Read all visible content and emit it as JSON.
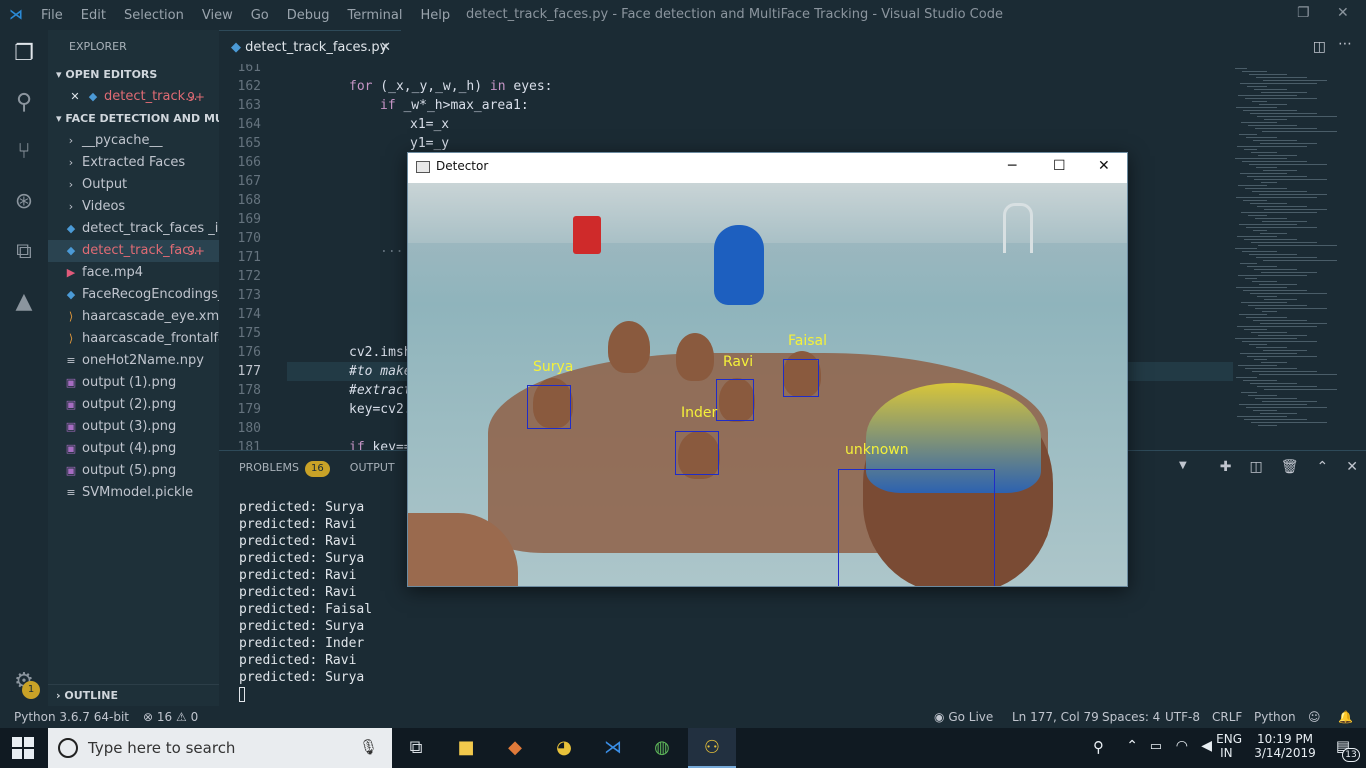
{
  "app": {
    "title": "detect_track_faces.py - Face detection and MultiFace Tracking - Visual Studio Code",
    "menu": [
      "File",
      "Edit",
      "Selection",
      "View",
      "Go",
      "Debug",
      "Terminal",
      "Help"
    ]
  },
  "sidebar": {
    "header": "EXPLORER",
    "open_editors_label": "OPEN EDITORS",
    "open_editor": {
      "name": "detect_track...",
      "count": "9+"
    },
    "project_label": "FACE DETECTION AND MU...",
    "items": [
      {
        "label": "__pycache__",
        "icon": "chevron-right-icon",
        "glyph": "›"
      },
      {
        "label": "Extracted Faces",
        "icon": "chevron-right-icon",
        "glyph": "›"
      },
      {
        "label": "Output",
        "icon": "chevron-right-icon",
        "glyph": "›"
      },
      {
        "label": "Videos",
        "icon": "chevron-right-icon",
        "glyph": "›"
      },
      {
        "label": "detect_track_faces _i...",
        "icon": "python-file-icon",
        "glyph": "◆"
      },
      {
        "label": "detect_track_fac...",
        "icon": "python-file-icon",
        "glyph": "◆",
        "count": "9+"
      },
      {
        "label": "face.mp4",
        "icon": "video-file-icon",
        "glyph": "▶"
      },
      {
        "label": "FaceRecogEncodings_...",
        "icon": "python-file-icon",
        "glyph": "◆"
      },
      {
        "label": "haarcascade_eye.xml",
        "icon": "xml-file-icon",
        "glyph": "⟩"
      },
      {
        "label": "haarcascade_frontalfa...",
        "icon": "xml-file-icon",
        "glyph": "⟩"
      },
      {
        "label": "oneHot2Name.npy",
        "icon": "file-icon",
        "glyph": "≡"
      },
      {
        "label": "output (1).png",
        "icon": "image-file-icon",
        "glyph": "▣"
      },
      {
        "label": "output (2).png",
        "icon": "image-file-icon",
        "glyph": "▣"
      },
      {
        "label": "output (3).png",
        "icon": "image-file-icon",
        "glyph": "▣"
      },
      {
        "label": "output (4).png",
        "icon": "image-file-icon",
        "glyph": "▣"
      },
      {
        "label": "output (5).png",
        "icon": "image-file-icon",
        "glyph": "▣"
      },
      {
        "label": "SVMmodel.pickle",
        "icon": "file-icon",
        "glyph": "≡"
      }
    ],
    "outline_label": "OUTLINE",
    "settings_badge": "1"
  },
  "editor": {
    "tab_label": "detect_track_faces.py",
    "line_numbers": [
      "161",
      "162",
      "163",
      "164",
      "165",
      "166",
      "167",
      "168",
      "169",
      "170",
      "171",
      "172",
      "173",
      "174",
      "175",
      "176",
      "177",
      "178",
      "179",
      "180",
      "181"
    ],
    "code": {
      "l162a": "for",
      "l162b": " (_x,_y,_w,_h) ",
      "l162c": "in",
      "l162d": " eyes:",
      "l163a": "if",
      "l163b": " _w*_h>max_area1:",
      "l164": "x1=_x",
      "l165": "y1=_y",
      "l171": "...",
      "l176": "cv2.imsh",
      "l177": "#to make",
      "l178": "#extract",
      "l179": "key=cv2.",
      "l181a": "if",
      "l181b": " key=="
    }
  },
  "panel": {
    "problems_label": "PROBLEMS",
    "problems_count": "16",
    "output_label": "OUTPUT",
    "terminal_lines": [
      "predicted: Surya",
      "predicted: Ravi",
      "predicted: Ravi",
      "predicted: Surya",
      "predicted: Ravi",
      "predicted: Ravi",
      "predicted: Faisal",
      "predicted: Surya",
      "predicted: Inder",
      "predicted: Ravi",
      "predicted: Surya"
    ]
  },
  "status": {
    "interpreter": "Python 3.6.7 64-bit",
    "errors": "16",
    "warnings": "0",
    "go_live": "Go Live",
    "position": "Ln 177, Col 79",
    "spaces": "Spaces: 4",
    "encoding": "UTF-8",
    "eol": "CRLF",
    "language": "Python"
  },
  "detector": {
    "title": "Detector",
    "faces": [
      {
        "label": "Surya"
      },
      {
        "label": "Ravi"
      },
      {
        "label": "Faisal"
      },
      {
        "label": "Inder"
      },
      {
        "label": "unknown"
      }
    ]
  },
  "taskbar": {
    "search_placeholder": "Type here to search",
    "lang1": "ENG",
    "lang2": "IN",
    "time": "10:19 PM",
    "date": "3/14/2019",
    "notifications": "13"
  },
  "colors": {
    "editor_bg": "#1b2b34",
    "sidebar_bg": "#1e3039",
    "face_box": "#1f2cc8",
    "face_label": "#f4f13a",
    "badge": "#c9a227"
  }
}
